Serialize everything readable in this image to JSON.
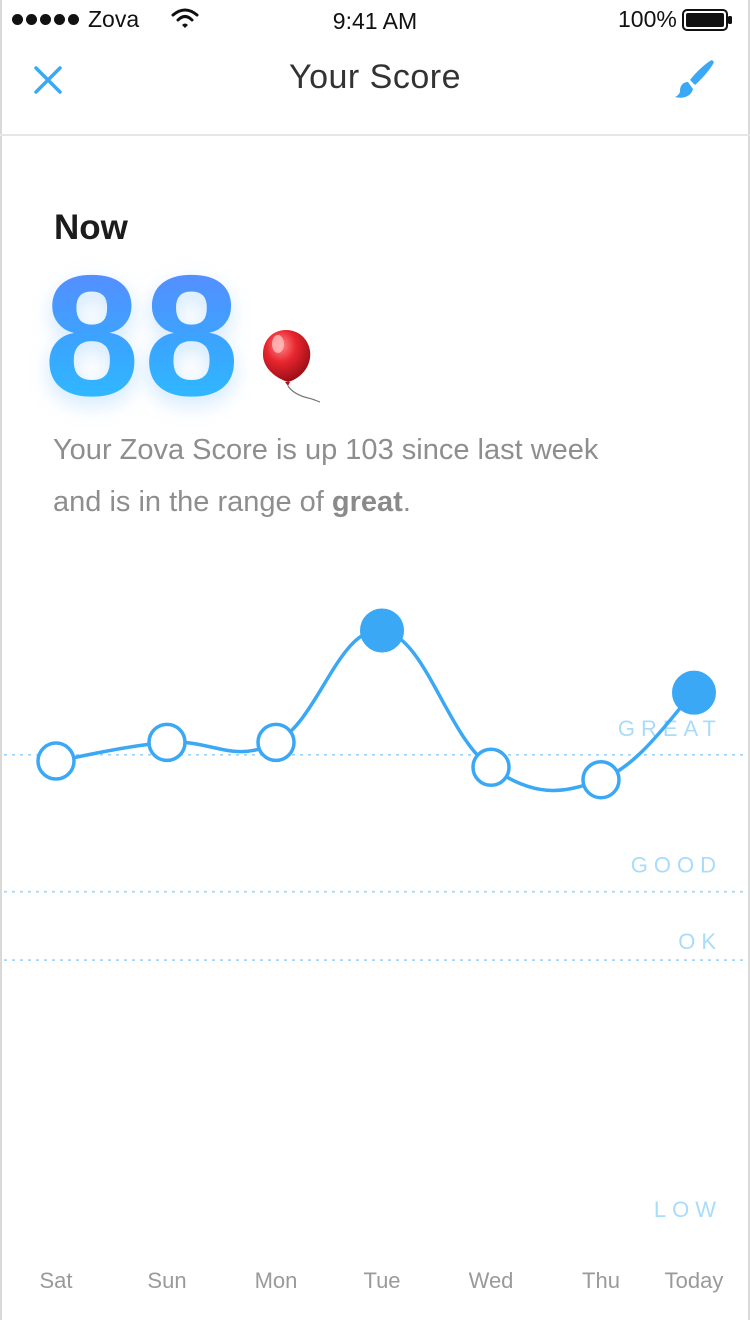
{
  "status_bar": {
    "carrier": "Zova",
    "time": "9:41 AM",
    "battery": "100%"
  },
  "nav": {
    "title": "Your Score",
    "left_icon": "close-icon",
    "right_icon": "brush-icon"
  },
  "score": {
    "label": "Now",
    "value": "88",
    "emoji": "balloon",
    "summary_prefix": "Your Zova Score is up 103 since last week and is in the range of ",
    "summary_range": "great",
    "summary_suffix": "."
  },
  "colors": {
    "accent": "#3aa8f5",
    "zone_label": "#a9dcfb",
    "text_muted": "#8e8e8e"
  },
  "chart_data": {
    "type": "line",
    "categories": [
      "Sat",
      "Sun",
      "Mon",
      "Tue",
      "Wed",
      "Thu",
      "Today"
    ],
    "values": [
      77,
      80,
      80,
      98,
      76,
      74,
      88
    ],
    "highlighted": [
      false,
      false,
      false,
      true,
      false,
      false,
      true
    ],
    "ylim": [
      0,
      100
    ],
    "zones": [
      {
        "label": "GREAT",
        "threshold": 78
      },
      {
        "label": "GOOD",
        "threshold": 56
      },
      {
        "label": "OK",
        "threshold": 45
      },
      {
        "label": "LOW",
        "threshold": 0
      }
    ]
  }
}
